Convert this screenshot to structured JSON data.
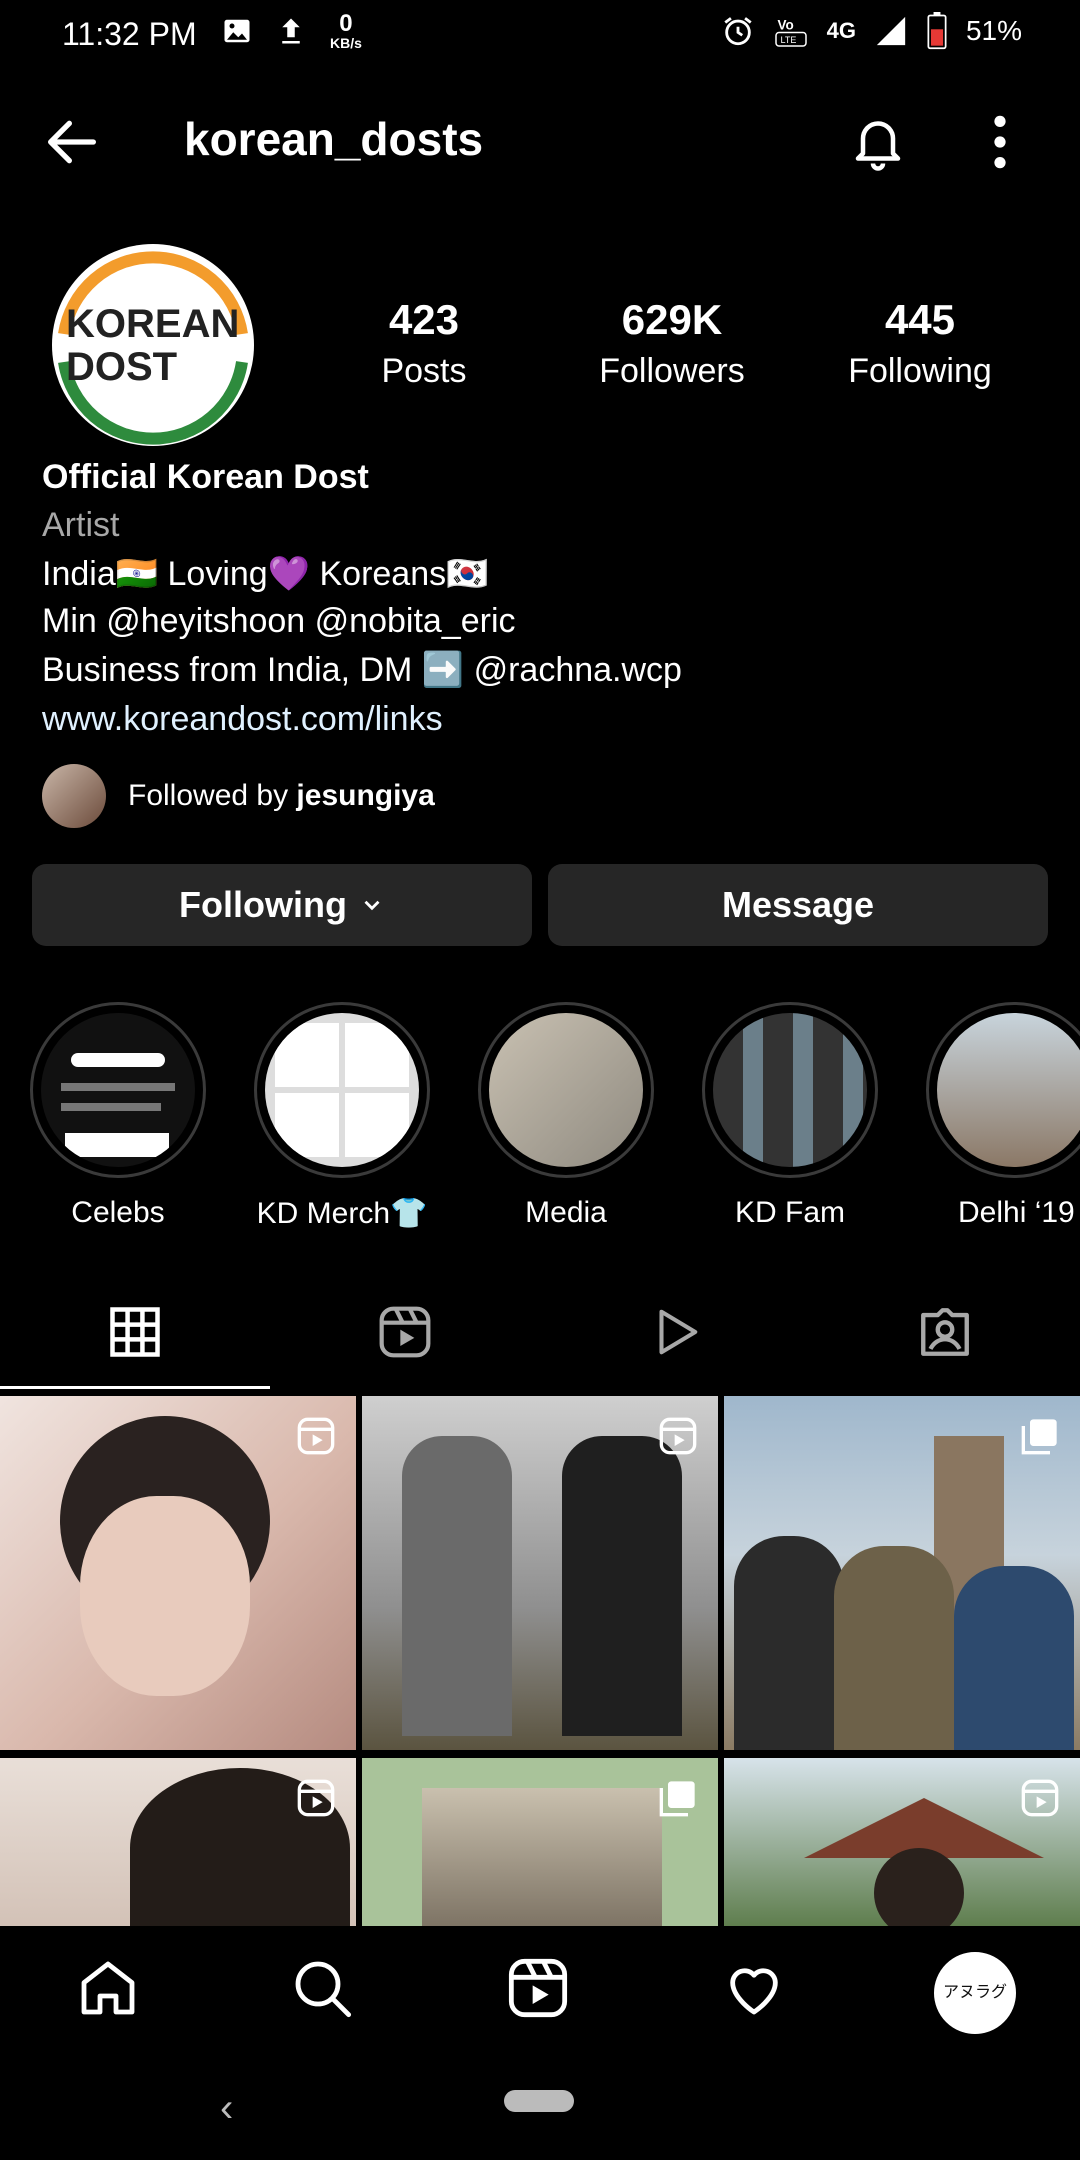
{
  "status_bar": {
    "time": "11:32 PM",
    "net_speed_value": "0",
    "net_speed_unit": "KB/s",
    "network": "4G",
    "battery": "51%"
  },
  "header": {
    "username": "korean_dosts"
  },
  "profile": {
    "avatar_text_line1": "KOREAN",
    "avatar_text_line2": "DOST",
    "stats": [
      {
        "value": "423",
        "label": "Posts"
      },
      {
        "value": "629K",
        "label": "Followers"
      },
      {
        "value": "445",
        "label": "Following"
      }
    ],
    "display_name": "Official Korean Dost",
    "category": "Artist",
    "bio_lines": [
      "India🇮🇳 Loving💜 Koreans🇰🇷",
      "Min @heyitshoon @nobita_eric",
      "Business from India, DM ➡️ @rachna.wcp"
    ],
    "link": "www.koreandost.com/links",
    "followed_by_prefix": "Followed by ",
    "followed_by_user": "jesungiya"
  },
  "actions": {
    "following_label": "Following",
    "message_label": "Message"
  },
  "highlights": [
    {
      "label": "Celebs"
    },
    {
      "label": "KD Merch👕"
    },
    {
      "label": "Media"
    },
    {
      "label": "KD Fam"
    },
    {
      "label": "Delhi ‘19"
    }
  ],
  "tabs": [
    "grid-icon",
    "reels-icon",
    "video-icon",
    "tagged-icon"
  ],
  "bottom_nav": [
    "home-icon",
    "search-icon",
    "reels-icon",
    "heart-icon",
    "profile-avatar"
  ],
  "bottom_nav_avatar_text": "アヌラグ",
  "colors": {
    "background": "#000000",
    "button": "#262626",
    "muted_text": "#a8a8a8",
    "link": "#e0f1ff"
  }
}
